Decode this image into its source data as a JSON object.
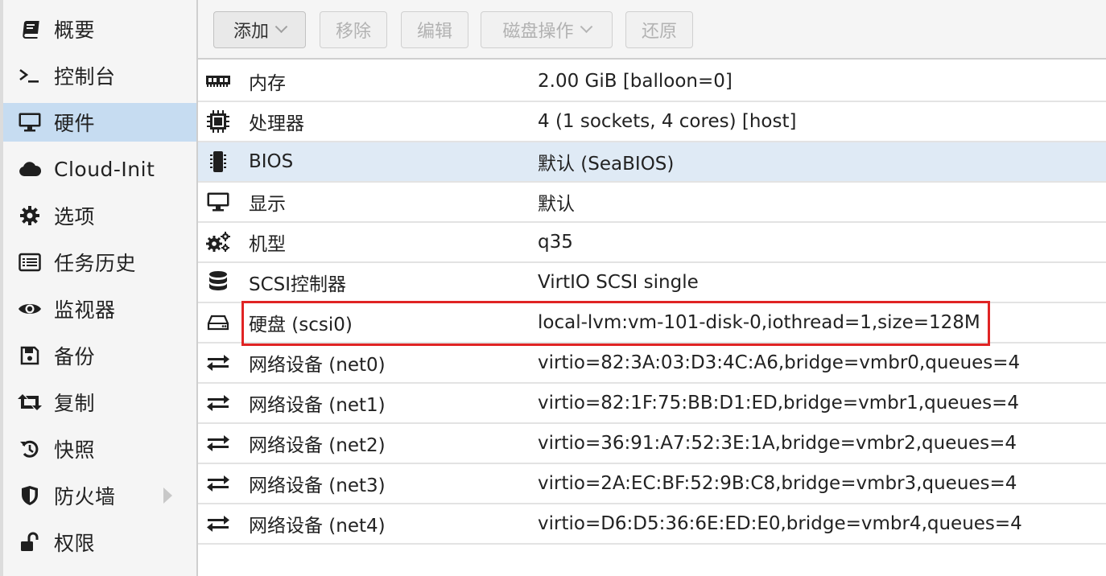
{
  "sidebar": {
    "items": [
      {
        "label": "概要",
        "icon": "book-icon",
        "active": false
      },
      {
        "label": "控制台",
        "icon": "terminal-icon",
        "active": false
      },
      {
        "label": "硬件",
        "icon": "desktop-icon",
        "active": true
      },
      {
        "label": "Cloud-Init",
        "icon": "cloud-icon",
        "active": false
      },
      {
        "label": "选项",
        "icon": "gear-icon",
        "active": false
      },
      {
        "label": "任务历史",
        "icon": "list-icon",
        "active": false
      },
      {
        "label": "监视器",
        "icon": "eye-icon",
        "active": false
      },
      {
        "label": "备份",
        "icon": "floppy-icon",
        "active": false
      },
      {
        "label": "复制",
        "icon": "retweet-icon",
        "active": false
      },
      {
        "label": "快照",
        "icon": "history-icon",
        "active": false
      },
      {
        "label": "防火墙",
        "icon": "shield-icon",
        "active": false
      },
      {
        "label": "权限",
        "icon": "unlock-icon",
        "active": false
      }
    ]
  },
  "toolbar": {
    "add_label": "添加",
    "remove_label": "移除",
    "edit_label": "编辑",
    "disk_action_label": "磁盘操作",
    "revert_label": "还原"
  },
  "hardware": {
    "rows": [
      {
        "name": "内存",
        "value": "2.00 GiB [balloon=0]",
        "icon": "memory-icon"
      },
      {
        "name": "处理器",
        "value": "4 (1 sockets, 4 cores) [host]",
        "icon": "cpu-icon"
      },
      {
        "name": "BIOS",
        "value": "默认 (SeaBIOS)",
        "icon": "microchip-icon"
      },
      {
        "name": "显示",
        "value": "默认",
        "icon": "desktop-icon"
      },
      {
        "name": "机型",
        "value": "q35",
        "icon": "cogs-icon"
      },
      {
        "name": "SCSI控制器",
        "value": "VirtIO SCSI single",
        "icon": "database-icon"
      },
      {
        "name": "硬盘 (scsi0)",
        "value": "local-lvm:vm-101-disk-0,iothread=1,size=128M",
        "icon": "hdd-icon"
      },
      {
        "name": "网络设备 (net0)",
        "value": "virtio=82:3A:03:D3:4C:A6,bridge=vmbr0,queues=4",
        "icon": "exchange-icon"
      },
      {
        "name": "网络设备 (net1)",
        "value": "virtio=82:1F:75:BB:D1:ED,bridge=vmbr1,queues=4",
        "icon": "exchange-icon"
      },
      {
        "name": "网络设备 (net2)",
        "value": "virtio=36:91:A7:52:3E:1A,bridge=vmbr2,queues=4",
        "icon": "exchange-icon"
      },
      {
        "name": "网络设备 (net3)",
        "value": "virtio=2A:EC:BF:52:9B:C8,bridge=vmbr3,queues=4",
        "icon": "exchange-icon"
      },
      {
        "name": "网络设备 (net4)",
        "value": "virtio=D6:D5:36:6E:ED:E0,bridge=vmbr4,queues=4",
        "icon": "exchange-icon"
      }
    ]
  },
  "colors": {
    "active_nav": "#c6dcf1",
    "selected_row": "#dfeaf5",
    "highlight_border": "#e02424"
  }
}
